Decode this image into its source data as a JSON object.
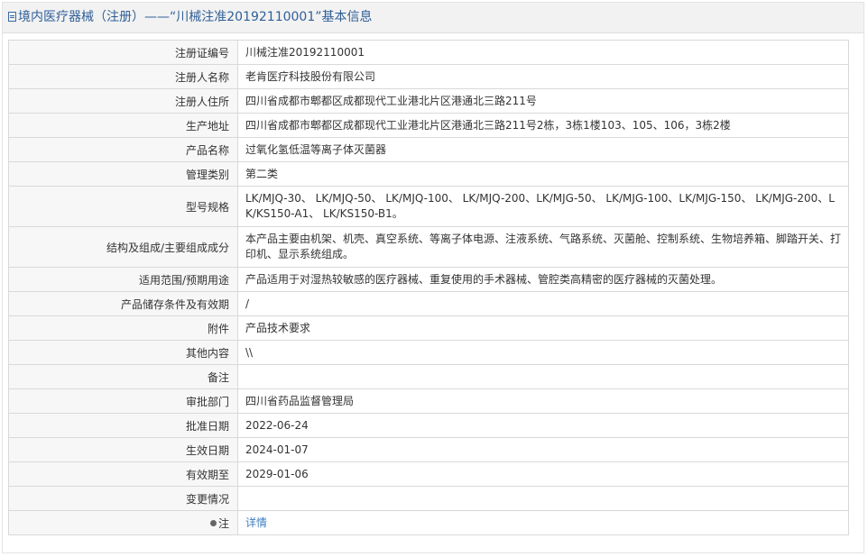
{
  "header": {
    "title": "境内医疗器械（注册）——“川械注准20192110001”基本信息"
  },
  "rows": [
    {
      "label": "注册证编号",
      "value": "川械注准20192110001"
    },
    {
      "label": "注册人名称",
      "value": "老肯医疗科技股份有限公司"
    },
    {
      "label": "注册人住所",
      "value": "四川省成都市郫都区成都现代工业港北片区港通北三路211号"
    },
    {
      "label": "生产地址",
      "value": "四川省成都市郫都区成都现代工业港北片区港通北三路211号2栋，3栋1楼103、105、106，3栋2楼"
    },
    {
      "label": "产品名称",
      "value": "过氧化氢低温等离子体灭菌器"
    },
    {
      "label": "管理类别",
      "value": "第二类"
    },
    {
      "label": "型号规格",
      "value": "LK/MJQ-30、 LK/MJQ-50、 LK/MJQ-100、 LK/MJQ-200、LK/MJG-50、 LK/MJG-100、LK/MJG-150、 LK/MJG-200、LK/KS150-A1、 LK/KS150-B1。"
    },
    {
      "label": "结构及组成/主要组成成分",
      "value": "本产品主要由机架、机壳、真空系统、等离子体电源、注液系统、气路系统、灭菌舱、控制系统、生物培养箱、脚踏开关、打印机、显示系统组成。"
    },
    {
      "label": "适用范围/预期用途",
      "value": "产品适用于对湿热较敏感的医疗器械、重复使用的手术器械、管腔类高精密的医疗器械的灭菌处理。"
    },
    {
      "label": "产品储存条件及有效期",
      "value": "/"
    },
    {
      "label": "附件",
      "value": "产品技术要求"
    },
    {
      "label": "其他内容",
      "value": "\\\\"
    },
    {
      "label": "备注",
      "value": ""
    },
    {
      "label": "审批部门",
      "value": "四川省药品监督管理局"
    },
    {
      "label": "批准日期",
      "value": "2022-06-24"
    },
    {
      "label": "生效日期",
      "value": "2024-01-07"
    },
    {
      "label": "有效期至",
      "value": "2029-01-06"
    },
    {
      "label": "变更情况",
      "value": ""
    }
  ],
  "note_row": {
    "label": "注",
    "link_text": "详情"
  }
}
